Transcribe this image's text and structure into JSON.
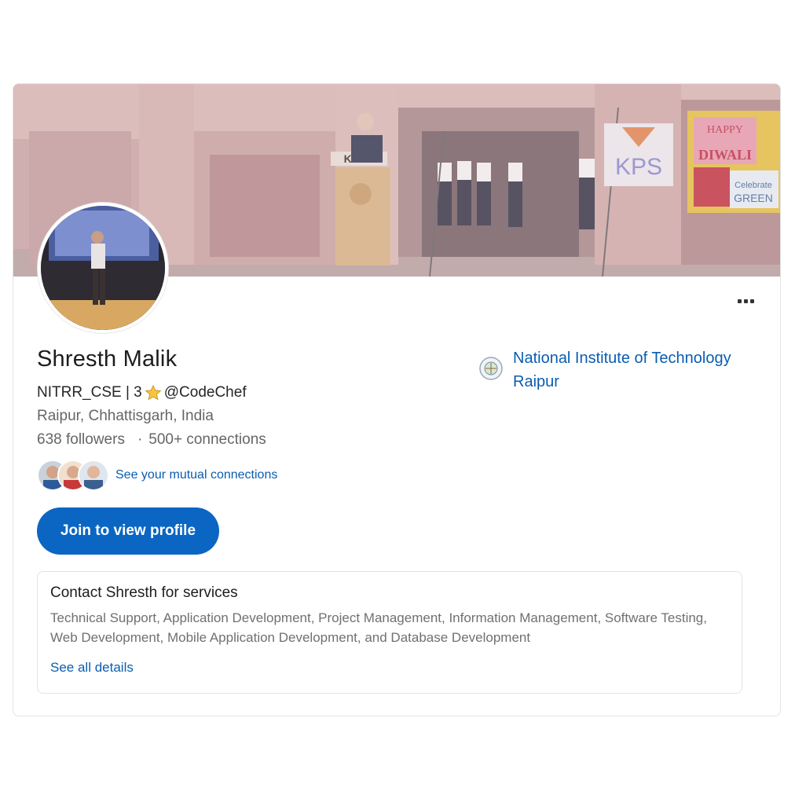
{
  "profile": {
    "name": "Shresth Malik",
    "headline_before": "NITRR_CSE | 3",
    "headline_after": "@CodeChef",
    "location": "Raipur, Chhattisgarh, India",
    "followers": "638 followers",
    "separator": "·",
    "connections": "500+ connections",
    "mutual_link": "See your mutual connections",
    "join_button": "Join to view profile"
  },
  "cover": {
    "podium_sign": "K.P.S.",
    "poster_text_1": "HAPPY",
    "poster_text_2": "DIWALI",
    "poster_text_3": "Celebrate",
    "poster_text_4": "GREEN",
    "banner_text": "KPS"
  },
  "education": {
    "school": "National Institute of Technology Raipur"
  },
  "services": {
    "title": "Contact Shresth for services",
    "list": "Technical Support, Application Development, Project Management, Information Management, Software Testing, Web Development, Mobile Application Development, and Database Development",
    "link": "See all details"
  },
  "colors": {
    "primary": "#0a66c2",
    "link": "#0a5db0"
  },
  "icons": [
    "more-icon",
    "star-icon",
    "school-logo-icon"
  ]
}
